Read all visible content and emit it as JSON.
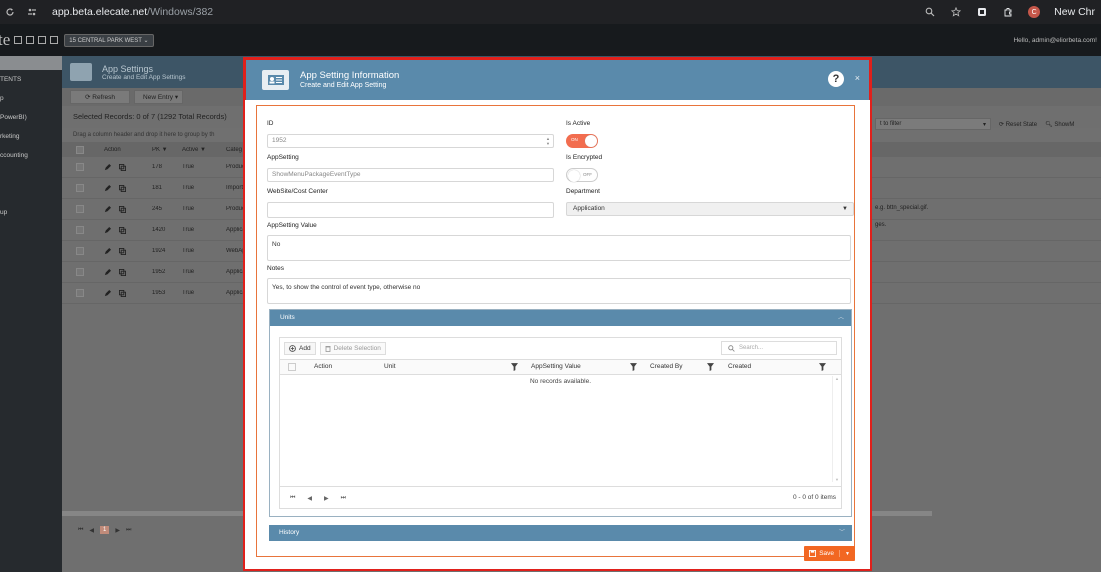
{
  "browser": {
    "url_host": "app.beta.elecate.net",
    "url_path": "/Windows/382",
    "new_chrome": "New Chr",
    "profile_initial": "C"
  },
  "app": {
    "logo": "te",
    "location": "15 CENTRAL PARK WEST",
    "hello": "Hello, admin@eliorbeta.com!"
  },
  "sidebar": {
    "items": [
      "TENTS",
      "p",
      "PowerBI)",
      "rketing",
      "ccounting",
      "",
      "",
      "up"
    ]
  },
  "page": {
    "title": "App Settings",
    "subtitle": "Create and Edit App Settings",
    "refresh": "Refresh",
    "new_entry": "New Entry",
    "selected_records": "Selected Records: 0 of 7 (1292 Total Records)",
    "drag_hint": "Drag a column header and drop it here to group by th",
    "filter_placeholder": "t to filter",
    "reset_state": "Reset State",
    "show": "ShowM",
    "columns": {
      "action": "Action",
      "pk": "PK",
      "active": "Active",
      "category": "Categ"
    },
    "rows": [
      {
        "pk": "178",
        "active": "True",
        "cat": "Produc"
      },
      {
        "pk": "181",
        "active": "True",
        "cat": "Importe"
      },
      {
        "pk": "245",
        "active": "True",
        "cat": "Produc"
      },
      {
        "pk": "1420",
        "active": "True",
        "cat": "Applica"
      },
      {
        "pk": "1924",
        "active": "True",
        "cat": "WebAp"
      },
      {
        "pk": "1952",
        "active": "True",
        "cat": "Applica"
      },
      {
        "pk": "1953",
        "active": "True",
        "cat": "Applica"
      }
    ],
    "note1": "e.g. bttn_special.gif.",
    "note2": "ges.",
    "pager_page": "1"
  },
  "modal": {
    "title": "App Setting Information",
    "subtitle": "Create and Edit App Setting",
    "help": "?",
    "close": "×",
    "id_label": "ID",
    "id_value": "1952",
    "is_active_label": "Is Active",
    "is_active_text": "ON",
    "appsetting_label": "AppSetting",
    "appsetting_value": "ShowMenuPackageEventType",
    "is_encrypted_label": "Is Encrypted",
    "is_encrypted_text": "OFF",
    "website_label": "WebSite/Cost Center",
    "website_value": "",
    "department_label": "Department",
    "department_value": "Application",
    "appsetting_value_label": "AppSetting Value",
    "appsetting_value_text": "No",
    "notes_label": "Notes",
    "notes_text": "Yes, to show the control of event type, otherwise no",
    "units": {
      "title": "Units",
      "add": "Add",
      "delete_selection": "Delete Selection",
      "search_placeholder": "Search...",
      "columns": [
        "Action",
        "Unit",
        "AppSetting Value",
        "Created By",
        "Created"
      ],
      "empty": "No records available.",
      "count": "0 - 0 of 0 items"
    },
    "history_title": "History",
    "save": "Save"
  },
  "colors": {
    "accent_blue": "#5a8aab",
    "save_orange": "#f26722",
    "toggle_on": "#f26d4f",
    "modal_outline": "#e0201b"
  }
}
